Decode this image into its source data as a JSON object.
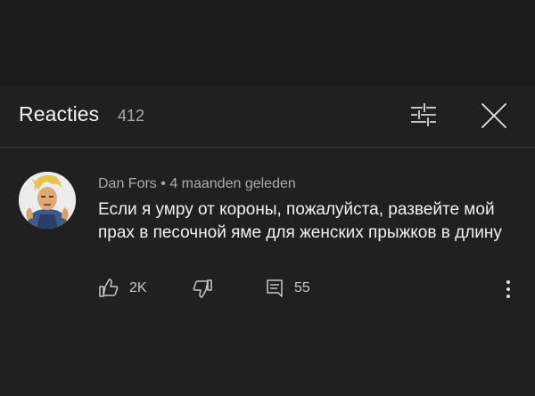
{
  "header": {
    "title": "Reacties",
    "count": "412"
  },
  "comment": {
    "author": "Dan Fors",
    "separator": "•",
    "time": "4 maanden geleden",
    "text": "Если я умру от короны, пожалуйста, развейте мой прах в песочной яме для женских прыжков в длину",
    "likes": "2K",
    "replies": "55"
  },
  "colors": {
    "background": "#202020",
    "topbar": "#1b1b1b",
    "text_primary": "#f1f1f1",
    "text_secondary": "#aaaaaa"
  },
  "icons": {
    "sort": "sort-icon",
    "close": "close-icon",
    "like": "thumb-up-icon",
    "dislike": "thumb-down-icon",
    "reply": "reply-icon",
    "more": "more-vert-icon"
  }
}
